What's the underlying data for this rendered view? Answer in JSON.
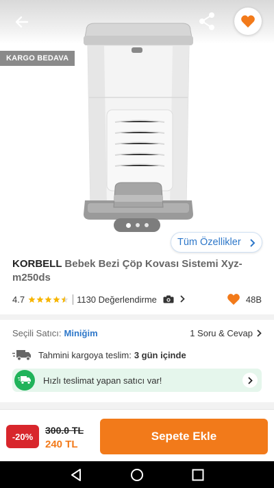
{
  "header": {
    "back_icon": "arrow-left-icon",
    "share_icon": "share-icon",
    "favorite_icon": "heart-icon"
  },
  "gallery": {
    "badge": "KARGO BEDAVA",
    "image_alt_icon": "diaper-pail-icon",
    "page_count": 3,
    "active_page": 1,
    "all_features_label": "Tüm Özellikler"
  },
  "product": {
    "brand": "KORBELL",
    "name": "Bebek Bezi Çöp Kovası Sistemi Xyz-m250ds",
    "rating": "4.7",
    "stars_filled": 4.5,
    "review_count_label": "1130 Değerlendirme",
    "favorite_count": "48B"
  },
  "seller": {
    "label": "Seçili Satıcı:",
    "name": "Miniğim",
    "qa_label": "1 Soru & Cevap"
  },
  "shipping": {
    "label": "Tahmini kargoya teslim:",
    "value": "3 gün içinde",
    "fast_label": "Hızlı teslimat yapan satıcı var!"
  },
  "bottom_bar": {
    "discount": "-20%",
    "old_price": "300.0 TL",
    "new_price": "240 TL",
    "add_to_cart_label": "Sepete Ekle"
  },
  "colors": {
    "accent": "#f27a1a",
    "link_blue": "#2d77c9",
    "discount_red": "#d8262c",
    "fast_green": "#20b35a"
  }
}
